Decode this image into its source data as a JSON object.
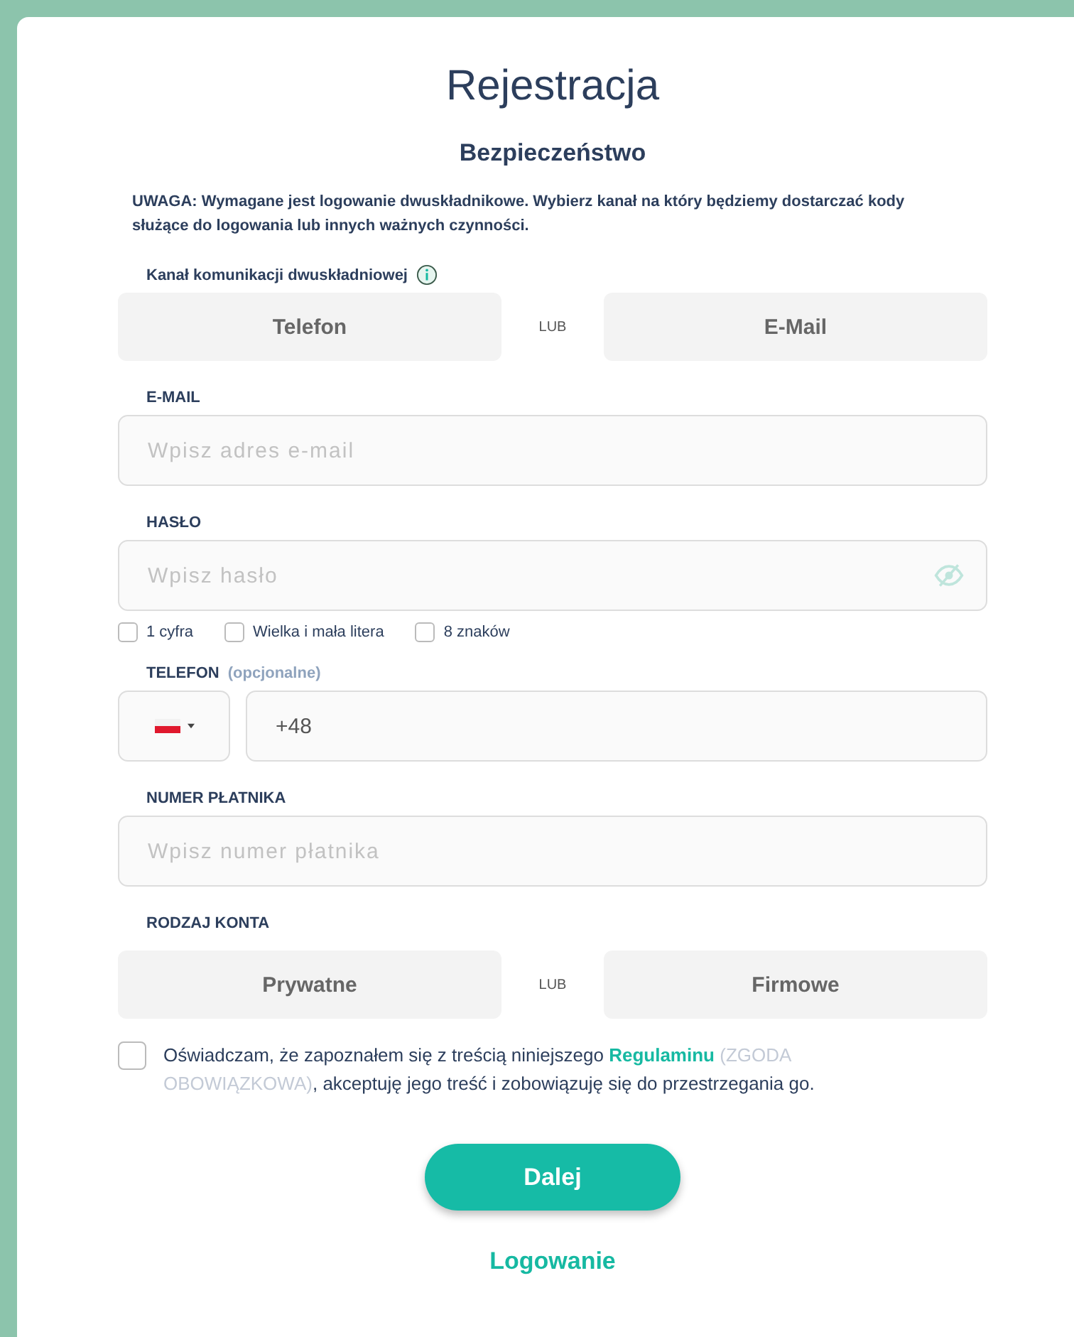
{
  "title": "Rejestracja",
  "subtitle": "Bezpieczeństwo",
  "notice": "**UWAGA: Wymagane jest logowanie dwuskładnikowe. Wybierz kanał na który będziemy dostarczać kody służące do logowania lub innych ważnych czynności.**",
  "channel": {
    "label": "Kanał komunikacji dwuskładniowej",
    "or": "LUB",
    "options": [
      {
        "label": "Telefon",
        "selected": false
      },
      {
        "label": "E-Mail",
        "selected": false
      }
    ]
  },
  "email": {
    "label": "E-MAIL",
    "placeholder": "Wpisz adres e-mail"
  },
  "password": {
    "label": "HASŁO",
    "placeholder": "Wpisz hasło",
    "rules": [
      {
        "label": "1 cyfra",
        "checked": false
      },
      {
        "label": "Wielka i mała litera",
        "checked": false
      },
      {
        "label": "8 znaków",
        "checked": false
      }
    ]
  },
  "phone": {
    "label": "TELEFON",
    "hint": "(opcjonalne)",
    "value": "+48"
  },
  "payer": {
    "label": "NUMER PŁATNIKA",
    "placeholder": "Wpisz numer płatnika"
  },
  "account": {
    "label": "RODZAJ KONTA",
    "or": "LUB",
    "options": [
      {
        "label": "Prywatne",
        "selected": false
      },
      {
        "label": "Firmowe",
        "selected": false
      }
    ]
  },
  "consent": {
    "checked": false,
    "before": "Oświadczam, że zapoznałem się z treścią niniejszego",
    "link": "Regulaminu",
    "note": "(ZGODA OBOWIĄZKOWA)",
    "after": ", akceptuję jego treść i zobowiązuję się do przestrzegania go."
  },
  "next_button": "Dalej",
  "login_link": "Logowanie"
}
